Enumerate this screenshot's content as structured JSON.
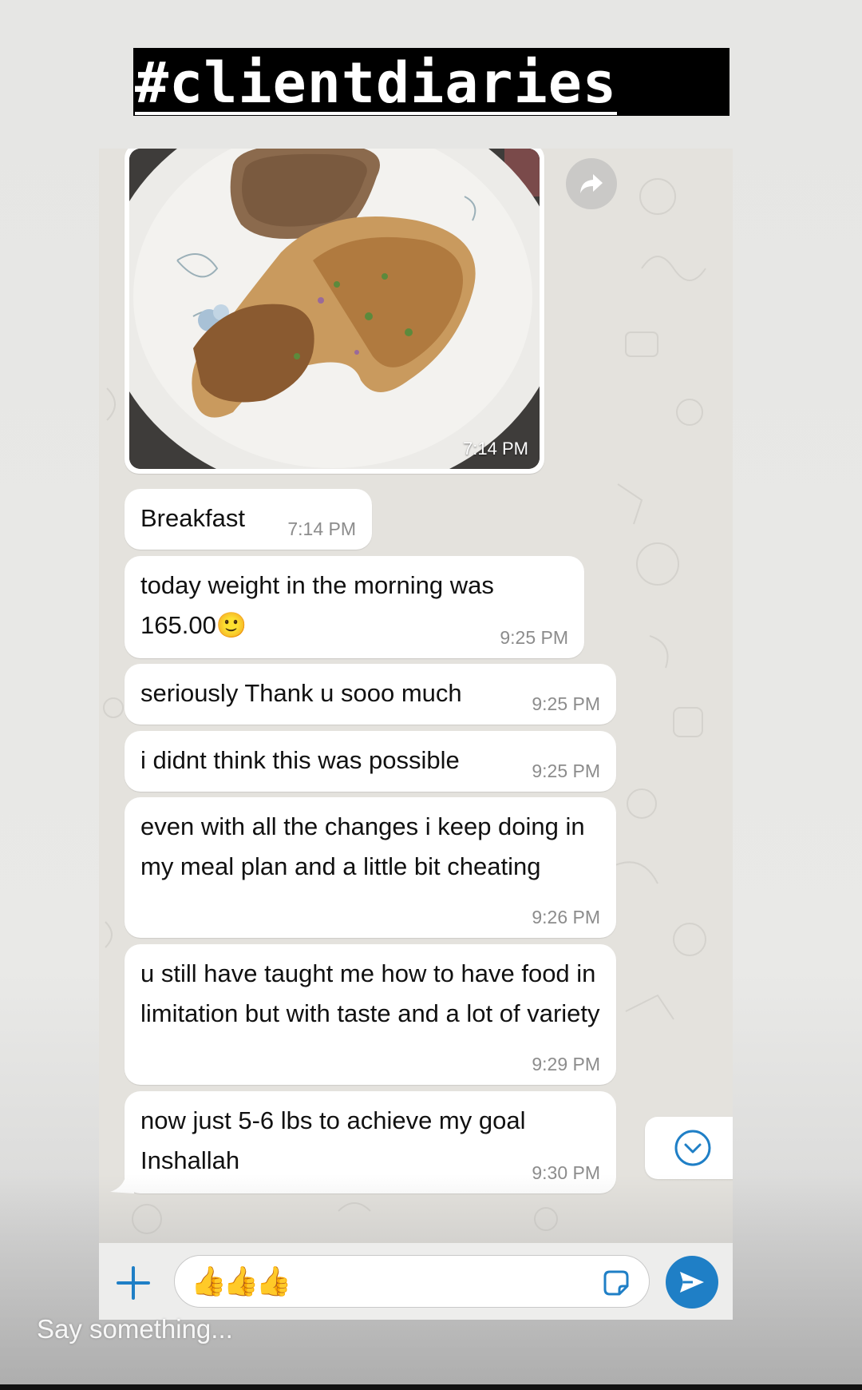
{
  "story": {
    "title": "#clientdiaries",
    "reply_placeholder": "Say something..."
  },
  "chat": {
    "image_message": {
      "time": "7:14 PM",
      "forward_icon": "forward-icon"
    },
    "messages": [
      {
        "text": "Breakfast",
        "time": "7:14 PM"
      },
      {
        "text": "today weight in the morning was 165.00🙂",
        "time": "9:25 PM"
      },
      {
        "text": "seriously Thank u sooo much",
        "time": "9:25 PM"
      },
      {
        "text": "i didnt think this was possible",
        "time": "9:25 PM"
      },
      {
        "text": "even with all the changes i keep doing in my meal plan and a little bit cheating",
        "time": "9:26 PM"
      },
      {
        "text": "u still have taught me how to have food in limitation but with taste and a lot of variety",
        "time": "9:29 PM"
      },
      {
        "text": "now just 5-6 lbs to achieve my goal Inshallah",
        "time": "9:30 PM"
      }
    ],
    "scroll_down_icon": "chevron-down-circle-icon"
  },
  "composer": {
    "value": "👍👍👍",
    "plus_icon": "plus-icon",
    "sticker_icon": "sticker-icon",
    "send_icon": "send-icon"
  },
  "colors": {
    "accent": "#1f7fc6",
    "bubble": "#ffffff",
    "chat_bg": "#e4e2dd",
    "banner": "#000000"
  }
}
